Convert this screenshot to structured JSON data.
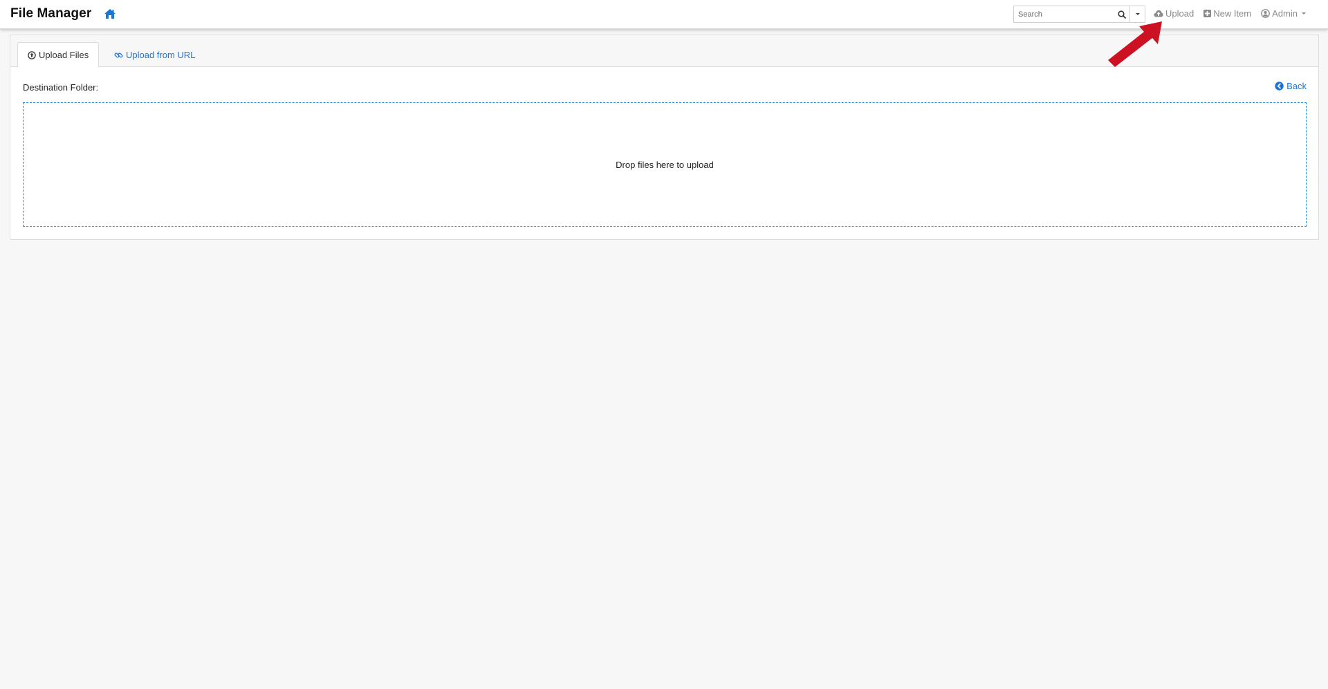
{
  "app": {
    "title": "File Manager"
  },
  "navbar": {
    "search_placeholder": "Search",
    "links": {
      "upload": "Upload",
      "new_item": "New Item",
      "user": "Admin"
    }
  },
  "tabs": {
    "upload_files": "Upload Files",
    "upload_from_url": "Upload from URL"
  },
  "upload": {
    "destination_label": "Destination Folder:",
    "back": "Back",
    "dropzone_text": "Drop files here to upload"
  },
  "colors": {
    "link": "#1a75d8",
    "annotation_arrow": "#cc1122",
    "dropzone_border": "#2a8ad8"
  },
  "icons": {
    "home": "home-icon",
    "search": "search-icon",
    "upload": "cloud-upload-icon",
    "new_item": "plus-square-icon",
    "user": "user-circle-icon",
    "upload_tab": "arrow-circle-up-icon",
    "url_tab": "link-icon",
    "back": "chevron-circle-left-icon"
  }
}
